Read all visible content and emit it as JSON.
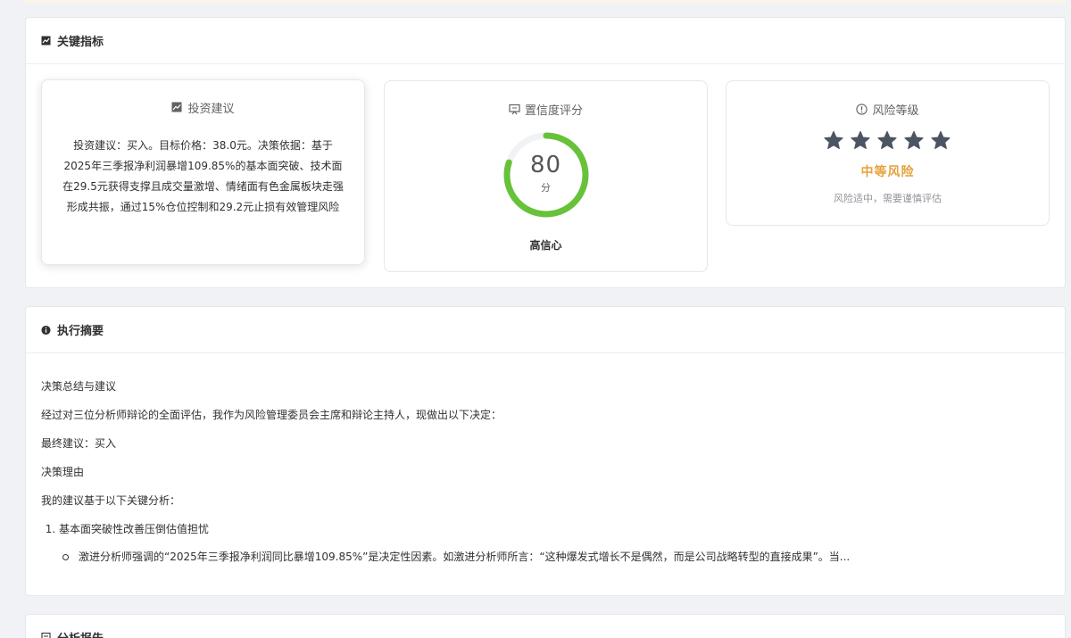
{
  "metrics": {
    "header": "关键指标",
    "advice": {
      "title": "投资建议",
      "text": "投资建议：买入。目标价格：38.0元。决策依据：基于2025年三季报净利润暴增109.85%的基本面突破、技术面在29.5元获得支撑且成交量激增、情绪面有色金属板块走强形成共振，通过15%仓位控制和29.2元止损有效管理风险"
    },
    "confidence": {
      "title": "置信度评分",
      "score": "80",
      "score_value": 0.8,
      "unit": "分",
      "label": "高信心",
      "color": "#67c23a"
    },
    "risk": {
      "title": "风险等级",
      "stars_filled": 5,
      "stars_total": 5,
      "level": "中等风险",
      "desc": "风险适中，需要谨慎评估",
      "level_color": "#e6a23c"
    }
  },
  "summary": {
    "header": "执行摘要",
    "p1": "决策总结与建议",
    "p2": "经过对三位分析师辩论的全面评估，我作为风险管理委员会主席和辩论主持人，现做出以下决定：",
    "p3": "最终建议：买入",
    "p4": "决策理由",
    "p5": "我的建议基于以下关键分析：",
    "item1": "基本面突破性改善压倒估值担忧",
    "item1_sub": "激进分析师强调的“2025年三季报净利润同比暴增109.85%”是决定性因素。如激进分析师所言：“这种爆发式增长不是偶然，而是公司战略转型的直接成果”。当..."
  },
  "report": {
    "header": "分析报告"
  }
}
